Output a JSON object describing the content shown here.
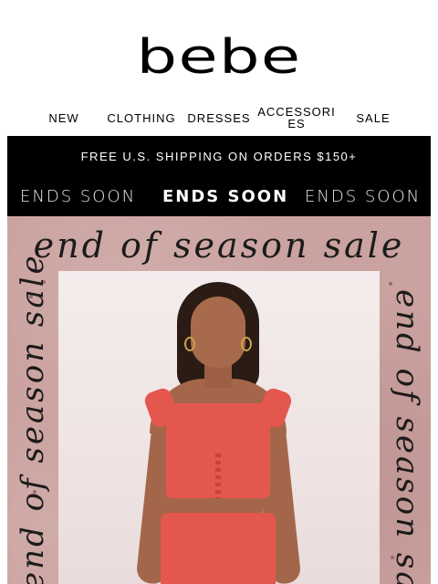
{
  "brand": {
    "logo": "bebe"
  },
  "nav": {
    "items": [
      "NEW",
      "CLOTHING",
      "DRESSES",
      "ACCESSORIES",
      "SALE"
    ]
  },
  "banner": {
    "shipping": "FREE U.S. SHIPPING ON ORDERS $150+",
    "ends": [
      "ENDS SOON",
      "ENDS SOON",
      "ENDS SOON"
    ]
  },
  "hero": {
    "script_top": "end of season sale",
    "script_left": "end of season sale",
    "script_right": "end of season sale"
  },
  "colors": {
    "banner_bg": "#000000",
    "hero_bg": "#caa29f",
    "top_color": "#e4574f"
  }
}
